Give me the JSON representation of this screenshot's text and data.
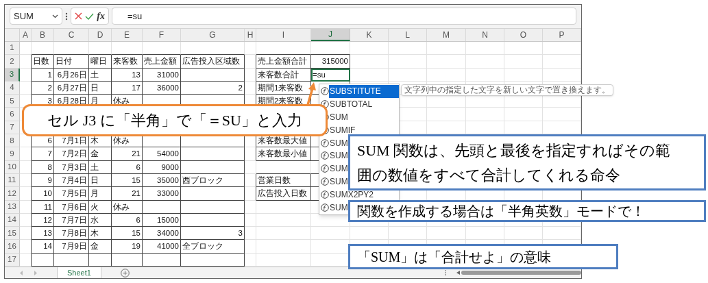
{
  "name_box": "SUM",
  "insert_function": "fx",
  "formula": "=su",
  "columns": [
    {
      "label": "A",
      "selected": false
    },
    {
      "label": "B",
      "selected": false
    },
    {
      "label": "C",
      "selected": false
    },
    {
      "label": "D",
      "selected": false
    },
    {
      "label": "E",
      "selected": false
    },
    {
      "label": "F",
      "selected": false
    },
    {
      "label": "G",
      "selected": false
    },
    {
      "label": "H",
      "selected": false
    },
    {
      "label": "I",
      "selected": false
    },
    {
      "label": "J",
      "selected": true
    },
    {
      "label": "K",
      "selected": false
    },
    {
      "label": "L",
      "selected": false
    },
    {
      "label": "M",
      "selected": false
    },
    {
      "label": "N",
      "selected": false
    },
    {
      "label": "O",
      "selected": false
    },
    {
      "label": "P",
      "selected": false
    }
  ],
  "rows": [
    {
      "label": "1",
      "selected": false
    },
    {
      "label": "2",
      "selected": false,
      "cells": {
        "B": "日数",
        "C": "日付",
        "D": "曜日",
        "E": "来客数",
        "F": "売上金額",
        "G": "広告投入区域数",
        "I": "売上金額合計",
        "J": "315000"
      }
    },
    {
      "label": "3",
      "selected": true,
      "cells": {
        "B": "1",
        "C": "6月26日",
        "D": "土",
        "E": "13",
        "F": "31000",
        "I": "来客数合計",
        "J": "=su"
      }
    },
    {
      "label": "4",
      "selected": false,
      "cells": {
        "B": "2",
        "C": "6月27日",
        "D": "日",
        "E": "17",
        "F": "36000",
        "G": "2",
        "I": "期間1来客数"
      }
    },
    {
      "label": "5",
      "selected": false,
      "cells": {
        "B": "3",
        "C": "6月28日",
        "D": "月",
        "E": "休み",
        "I": "期間2来客数"
      }
    },
    {
      "label": "6",
      "selected": false
    },
    {
      "label": "7",
      "selected": false
    },
    {
      "label": "8",
      "selected": false,
      "cells": {
        "B": "6",
        "C": "7月1日",
        "D": "木",
        "E": "休み",
        "I": "来客数最大値"
      }
    },
    {
      "label": "9",
      "selected": false,
      "cells": {
        "B": "7",
        "C": "7月2日",
        "D": "金",
        "E": "21",
        "F": "54000",
        "I": "来客数最小値"
      }
    },
    {
      "label": "10",
      "selected": false,
      "cells": {
        "B": "8",
        "C": "7月3日",
        "D": "土",
        "E": "6",
        "F": "9000"
      }
    },
    {
      "label": "11",
      "selected": false,
      "cells": {
        "B": "9",
        "C": "7月4日",
        "D": "日",
        "E": "15",
        "F": "35000",
        "G": "西ブロック",
        "I": "営業日数"
      }
    },
    {
      "label": "12",
      "selected": false,
      "cells": {
        "B": "10",
        "C": "7月5日",
        "D": "月",
        "E": "21",
        "F": "33000",
        "I": "広告投入日数"
      }
    },
    {
      "label": "13",
      "selected": false,
      "cells": {
        "B": "11",
        "C": "7月6日",
        "D": "火",
        "E": "休み"
      }
    },
    {
      "label": "14",
      "selected": false,
      "cells": {
        "B": "12",
        "C": "7月7日",
        "D": "水",
        "E": "6",
        "F": "15000"
      }
    },
    {
      "label": "15",
      "selected": false,
      "cells": {
        "B": "13",
        "C": "7月8日",
        "D": "木",
        "E": "15",
        "F": "34000",
        "G": "3"
      }
    },
    {
      "label": "16",
      "selected": false,
      "cells": {
        "B": "14",
        "C": "7月9日",
        "D": "金",
        "E": "19",
        "F": "41000",
        "G": "全ブロック"
      }
    },
    {
      "label": "17",
      "selected": false
    }
  ],
  "autocomplete": [
    {
      "label": "SUBSTITUTE",
      "selected": true
    },
    {
      "label": "SUBTOTAL",
      "selected": false
    },
    {
      "label": "SUM",
      "selected": false
    },
    {
      "label": "SUMIF",
      "selected": false
    },
    {
      "label": "SUM",
      "selected": false
    },
    {
      "label": "SUM",
      "selected": false
    },
    {
      "label": "SUM",
      "selected": false
    },
    {
      "label": "SUM",
      "selected": false
    },
    {
      "label": "SUMX2PY2",
      "selected": false
    },
    {
      "label": "SUM",
      "selected": false
    }
  ],
  "tooltip": "文字列中の指定した文字を新しい文字で置き換えます。",
  "sheet_tabs": [
    {
      "label": "Sheet1",
      "selected": true
    }
  ],
  "instruction_callout": "セル J3 に「半角」で「＝SU」と入力",
  "notes": [
    "SUM 関数は、先頭と最後を指定すればその範囲の数値をすべて合計してくれる命令",
    "関数を作成する場合は「半角英数」モードで！",
    "「SUM」は「合計せよ」の意味"
  ]
}
